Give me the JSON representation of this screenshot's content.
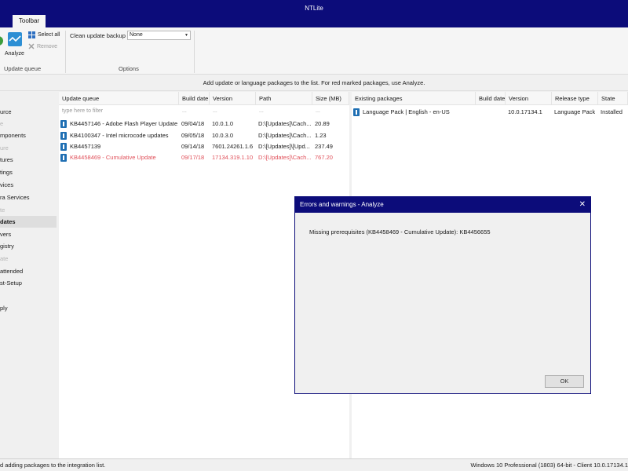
{
  "window": {
    "title": "NTLite"
  },
  "ribbon": {
    "tab": "Toolbar",
    "analyze_label": "Analyze",
    "select_all": "Select all",
    "remove": "Remove",
    "update_queue_group": "Update queue",
    "clean_update_backup_label": "Clean update backup",
    "clean_update_backup_value": "None",
    "options_group": "Options"
  },
  "info_bar": "Add update or language packages to the list. For red marked packages, use Analyze.",
  "sidebar": {
    "items": [
      {
        "label": "urce",
        "dim": false
      },
      {
        "label": "e",
        "dim": true
      },
      {
        "label": "mponents",
        "dim": false
      },
      {
        "label": "ure",
        "dim": true
      },
      {
        "label": "tures",
        "dim": false
      },
      {
        "label": "tings",
        "dim": false
      },
      {
        "label": "vices",
        "dim": false
      },
      {
        "label": "ra Services",
        "dim": false
      },
      {
        "label": "te",
        "dim": true
      },
      {
        "label": "dates",
        "dim": false,
        "active": true
      },
      {
        "label": "vers",
        "dim": false
      },
      {
        "label": "gistry",
        "dim": false
      },
      {
        "label": "ate",
        "dim": true
      },
      {
        "label": "attended",
        "dim": false
      },
      {
        "label": "st-Setup",
        "dim": false
      },
      {
        "label": "ply",
        "dim": false
      }
    ]
  },
  "update_queue": {
    "headers": [
      "Update queue",
      "Build date",
      "Version",
      "Path",
      "Size (MB)"
    ],
    "filter_placeholder": "type here to filter",
    "filter_dots": "...",
    "rows": [
      {
        "name": "KB4457146 - Adobe Flash Player Update",
        "date": "09/04/18",
        "version": "10.0.1.0",
        "path": "D:\\[Updates]\\Cach...",
        "size": "20.89",
        "icon": "package-icon",
        "red": false
      },
      {
        "name": "KB4100347 - Intel microcode updates",
        "date": "09/05/18",
        "version": "10.0.3.0",
        "path": "D:\\[Updates]\\Cach...",
        "size": "1.23",
        "icon": "package-icon",
        "red": false
      },
      {
        "name": "KB4457139",
        "date": "09/14/18",
        "version": "7601.24261.1.6",
        "path": "D:\\[Updates]\\[Upd...",
        "size": "237.49",
        "icon": "package-icon",
        "red": false
      },
      {
        "name": "KB4458469 - Cumulative Update",
        "date": "09/17/18",
        "version": "17134.319.1.10",
        "path": "D:\\[Updates]\\Cach...",
        "size": "767.20",
        "icon": "package-icon",
        "red": true
      }
    ]
  },
  "existing_packages": {
    "headers": [
      "Existing packages",
      "Build date",
      "Version",
      "Release type",
      "State"
    ],
    "rows": [
      {
        "name": "Language Pack  |  English - en-US",
        "date": "",
        "version": "10.0.17134.1",
        "release_type": "Language Pack",
        "state": "Installed",
        "icon": "package-icon"
      }
    ]
  },
  "dialog": {
    "title": "Errors and warnings - Analyze",
    "message": "Missing prerequisites (KB4458469 - Cumulative Update):  KB4456655",
    "ok": "OK"
  },
  "status": {
    "left": "d adding packages to the integration list.",
    "right": "Windows 10 Professional (1803) 64-bit - Client 10.0.17134.1"
  },
  "colors": {
    "titlebar": "#0c0c7a",
    "red_package": "#e0505a",
    "package_icon": "#1f6fb3"
  }
}
